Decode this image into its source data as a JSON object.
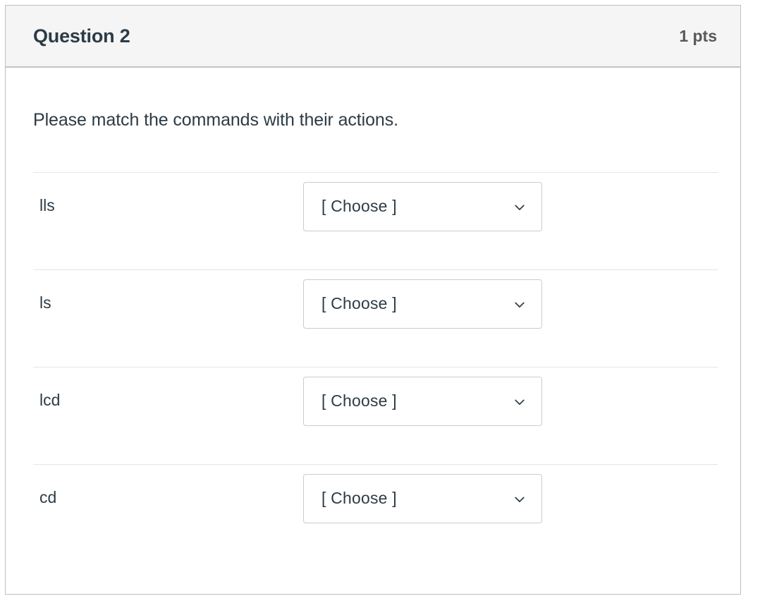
{
  "question": {
    "name": "Question 2",
    "points": "1 pts",
    "prompt": "Please match the commands with their actions.",
    "answers": [
      {
        "term": "lls",
        "selected": "[ Choose ]"
      },
      {
        "term": "ls",
        "selected": "[ Choose ]"
      },
      {
        "term": "lcd",
        "selected": "[ Choose ]"
      },
      {
        "term": "cd",
        "selected": "[ Choose ]"
      }
    ],
    "icons": {
      "dropdown": "chevron-down-icon"
    },
    "colors": {
      "text": "#2d3b45",
      "points_text": "#585858",
      "header_background": "#f5f5f5",
      "card_border": "#b9bfc3",
      "row_divider": "#e3e5e7",
      "select_border": "#c7cdd1"
    }
  }
}
